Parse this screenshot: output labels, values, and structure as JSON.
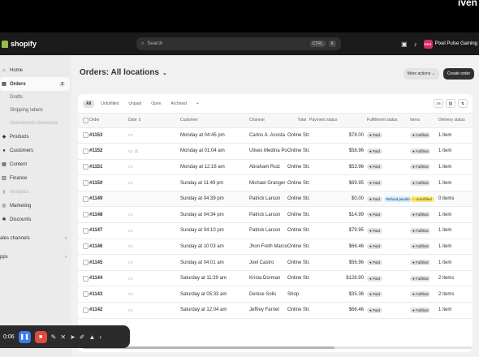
{
  "corner_text": "iven",
  "topbar": {
    "brand": "shopify",
    "search_placeholder": "Search",
    "search_shortcut_1": "CTRL",
    "search_shortcut_2": "K",
    "store_initials": "PPG",
    "store_name": "Pixel Pulse Gaming"
  },
  "sidebar": {
    "items": [
      {
        "label": "Home",
        "icon": "home-icon"
      },
      {
        "label": "Orders",
        "icon": "orders-icon",
        "count": "3"
      },
      {
        "label": "Drafts"
      },
      {
        "label": "Shipping labels"
      },
      {
        "label": "Abandoned checkouts"
      },
      {
        "label": "Products",
        "icon": "tag-icon"
      },
      {
        "label": "Customers",
        "icon": "person-icon"
      },
      {
        "label": "Content",
        "icon": "content-icon"
      },
      {
        "label": "Finance",
        "icon": "bank-icon"
      },
      {
        "label": "Analytics",
        "icon": "chart-icon"
      },
      {
        "label": "Marketing",
        "icon": "target-icon"
      },
      {
        "label": "Discounts",
        "icon": "discount-icon"
      },
      {
        "label": "ales channels"
      },
      {
        "label": "pps"
      }
    ]
  },
  "page": {
    "title": "Orders: All locations",
    "more_actions": "More actions",
    "create_order": "Create order"
  },
  "tabs": [
    "All",
    "Unfulfilled",
    "Unpaid",
    "Open",
    "Archived",
    "+"
  ],
  "columns": [
    "Order",
    "Date",
    "Customer",
    "Channel",
    "Total",
    "Payment status",
    "Fulfillment status",
    "Items",
    "Delivery status"
  ],
  "orders": [
    {
      "order": "#1153",
      "date": "Monday at 04:45 pm",
      "customer": "Carlos A. Acosta",
      "channel": "Online Store",
      "total": "$78.00",
      "payment": "Paid",
      "fulfillment": "Fulfilled",
      "items": "1 item",
      "delivery": "Tracking added"
    },
    {
      "order": "#1152",
      "date": "Monday at 01:04 am",
      "customer": "Ulises Medina Portida",
      "channel": "Online Store",
      "total": "$58.96",
      "payment": "Paid",
      "fulfillment": "Fulfilled",
      "items": "1 item",
      "delivery": "Tracking added",
      "warn": "⚠"
    },
    {
      "order": "#1151",
      "date": "Monday at 12:16 am",
      "customer": "Abraham Ruiz",
      "channel": "Online Store",
      "total": "$53.96",
      "payment": "Paid",
      "fulfillment": "Fulfilled",
      "items": "1 item",
      "delivery": "Tracking added"
    },
    {
      "order": "#1150",
      "date": "Sunday at 11:49 pm",
      "customer": "Michael Granger",
      "channel": "Online Store",
      "total": "$69.95",
      "payment": "Paid",
      "fulfillment": "Fulfilled",
      "items": "1 item",
      "delivery": "Tracking added"
    },
    {
      "order": "#1149",
      "date": "Sunday at 04:39 pm",
      "customer": "Patrick Larson",
      "channel": "Online Store",
      "total": "$0.00",
      "payment": "Paid",
      "refund": "Refund pending",
      "fulfillment": "Unfulfilled",
      "items": "0 items",
      "delivery": ""
    },
    {
      "order": "#1148",
      "date": "Sunday at 04:34 pm",
      "customer": "Patrick Larson",
      "channel": "Online Store",
      "total": "$14.99",
      "payment": "Paid",
      "fulfillment": "Fulfilled",
      "items": "1 item",
      "delivery": "Tracking added"
    },
    {
      "order": "#1147",
      "date": "Sunday at 04:10 pm",
      "customer": "Patrick Larson",
      "channel": "Online Store",
      "total": "$79.95",
      "payment": "Paid",
      "fulfillment": "Fulfilled",
      "items": "1 item",
      "delivery": "Tracking added"
    },
    {
      "order": "#1146",
      "date": "Sunday at 10:03 am",
      "customer": "Jhon Freth Marcos Grandez",
      "channel": "Online Store",
      "total": "$66.46",
      "payment": "Paid",
      "fulfillment": "Fulfilled",
      "items": "1 item",
      "delivery": "Tracking added"
    },
    {
      "order": "#1145",
      "date": "Sunday at 04:01 am",
      "customer": "Joel Castro",
      "channel": "Online Store",
      "total": "$56.96",
      "payment": "Paid",
      "fulfillment": "Fulfilled",
      "items": "1 item",
      "delivery": "Tracking added"
    },
    {
      "order": "#1144",
      "date": "Saturday at 11:39 am",
      "customer": "Krista Dorman",
      "channel": "Online Store",
      "total": "$128.90",
      "payment": "Paid",
      "fulfillment": "Fulfilled",
      "items": "2 items",
      "delivery": "Tracking added"
    },
    {
      "order": "#1143",
      "date": "Saturday at 05:33 am",
      "customer": "Denise Solis",
      "channel": "Shop",
      "total": "$35.36",
      "payment": "Paid",
      "fulfillment": "Fulfilled",
      "items": "2 items",
      "delivery": "Tracking added"
    },
    {
      "order": "#1142",
      "date": "Saturday at 12:04 am",
      "customer": "Jeffrey Farnet",
      "channel": "Online Store",
      "total": "$66.46",
      "payment": "Paid",
      "fulfillment": "Fulfilled",
      "items": "1 item",
      "delivery": "Tracking added"
    }
  ],
  "recorder": {
    "time": "0:06"
  },
  "colors": {
    "accent": "#303030",
    "brand": "#95bf47",
    "unfulfilled": "#ffeb78",
    "refund": "#d5ebff"
  }
}
